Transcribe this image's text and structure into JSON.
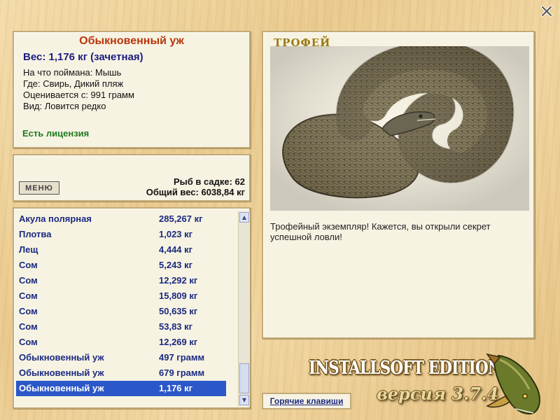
{
  "close_icon": "close-icon",
  "info": {
    "title": "Обыкновенный уж",
    "weight": "Вес: 1,176 кг (зачетная)",
    "caught_on": "На что поймана: Мышь",
    "where": "Где: Свирь, Дикий пляж",
    "valued": "Оценивается с: 991 грамм",
    "kind": "Вид: Ловится редко",
    "license": "Есть лицензия"
  },
  "stats": {
    "menu_label": "МЕНЮ",
    "fish_count": "Рыб в садке: 62",
    "total_weight": "Общий вес: 6038,84 кг"
  },
  "catch_list": [
    {
      "name": "Акула полярная",
      "weight": "285,267 кг"
    },
    {
      "name": "Плотва",
      "weight": "1,023 кг"
    },
    {
      "name": "Лещ",
      "weight": "4,444 кг"
    },
    {
      "name": "Сом",
      "weight": "5,243 кг"
    },
    {
      "name": "Сом",
      "weight": "12,292 кг"
    },
    {
      "name": "Сом",
      "weight": "15,809 кг"
    },
    {
      "name": "Сом",
      "weight": "50,635 кг"
    },
    {
      "name": "Сом",
      "weight": "53,83 кг"
    },
    {
      "name": "Сом",
      "weight": "12,269 кг"
    },
    {
      "name": "Обыкновенный уж",
      "weight": "497 грамм"
    },
    {
      "name": "Обыкновенный уж",
      "weight": "679 грамм"
    },
    {
      "name": "Обыкновенный уж",
      "weight": "1,176 кг",
      "selected": true
    }
  ],
  "trophy": {
    "title": "ТРОФЕЙ",
    "description": "Трофейный экземпляр! Кажется, вы открыли секрет успешной ловли!"
  },
  "hotkeys_label": "Горячие клавиши",
  "branding": {
    "edition": "INSTALLSOFT EDITION",
    "version": "версия 3.7.4"
  },
  "colors": {
    "title_red": "#b8360c",
    "list_blue": "#1a2a80",
    "selection": "#2b57c8",
    "license_green": "#1e7a1e"
  }
}
